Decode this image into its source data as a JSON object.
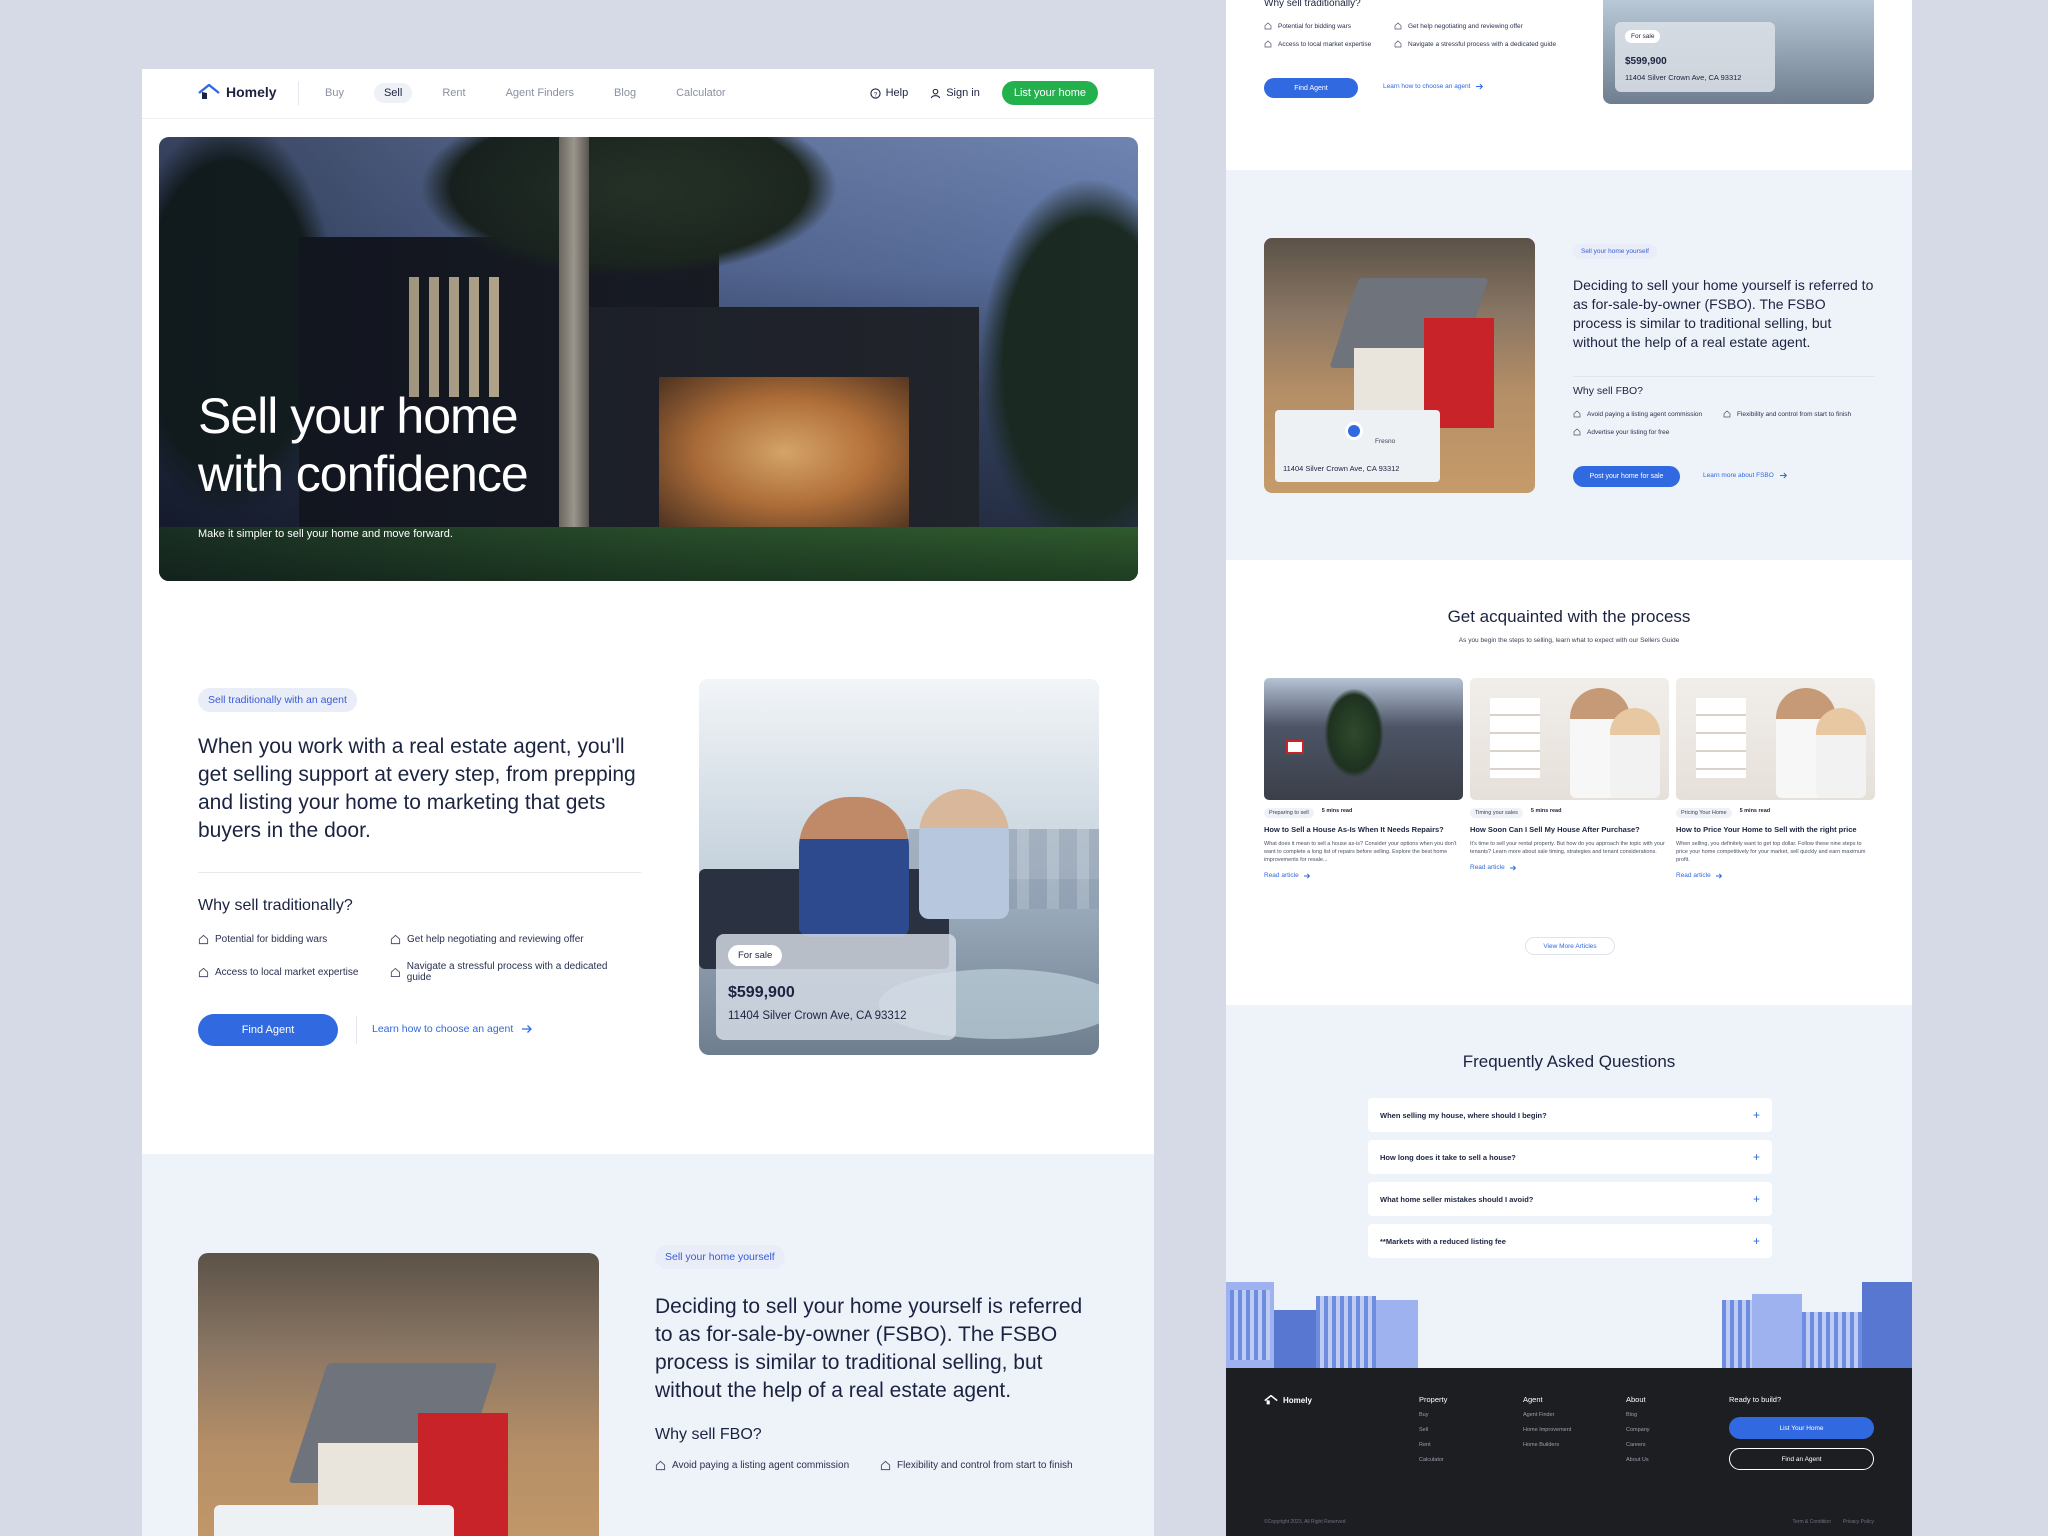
{
  "brand": {
    "name": "Homely",
    "accent": "#3169e0",
    "cta_green": "#22b14c"
  },
  "nav": {
    "links": [
      "Buy",
      "Sell",
      "Rent",
      "Agent Finders",
      "Blog",
      "Calculator"
    ],
    "active": "Sell",
    "help": "Help",
    "signin": "Sign in",
    "cta": "List your home"
  },
  "hero": {
    "title_line1": "Sell your home",
    "title_line2": "with confidence",
    "subtitle": "Make it simpler to sell your home and move forward."
  },
  "traditional": {
    "chip": "Sell traditionally with an agent",
    "lead": "When you work with a real estate agent, you'll get selling support at every step, from prepping and listing your home to marketing that gets buyers in the door.",
    "why_title": "Why sell traditionally?",
    "bullets": [
      "Potential for bidding wars",
      "Get help negotiating and reviewing offer",
      "Access to local market expertise",
      "Navigate a stressful process with a dedicated guide"
    ],
    "button": "Find Agent",
    "link": "Learn how to choose an agent",
    "card": {
      "tag": "For sale",
      "price": "$599,900",
      "address": "11404 Silver Crown Ave, CA 93312"
    }
  },
  "fsbo": {
    "chip": "Sell your home yourself",
    "lead": "Deciding to sell your home yourself is referred to as for-sale-by-owner (FSBO). The FSBO process is similar to traditional selling, but without the help of a real estate agent.",
    "why_title": "Why sell FBO?",
    "bullets": [
      "Avoid paying a listing agent commission",
      "Flexibility and control from start to finish",
      "Advertise your listing for free"
    ],
    "button": "Post your home for sale",
    "link": "Learn more about FSBO",
    "map": {
      "city": "Fresno",
      "address": "11404 Silver Crown Ave, CA 93312"
    }
  },
  "process": {
    "title": "Get acquainted with the process",
    "subtitle": "As you begin the steps to selling, learn what to expect with our Sellers Guide",
    "articles": [
      {
        "tag": "Preparing to sell",
        "read": "5 mins read",
        "title": "How to Sell a House As-Is When It Needs Repairs?",
        "desc": "What does it mean to sell a house as-is? Consider your options when you don't want to complete a long list of repairs before selling. Explore the best home improvements for resale...",
        "cta": "Read article"
      },
      {
        "tag": "Timing your sales",
        "read": "5 mins read",
        "title": "How Soon Can I Sell My House After Purchase?",
        "desc": "It's time to sell your rental property. But how do you approach the topic with your tenants? Learn more about sale timing, strategies and tenant considerations.",
        "cta": "Read article"
      },
      {
        "tag": "Pricing Your Home",
        "read": "5 mins read",
        "title": "How to Price Your Home to Sell with the right price",
        "desc": "When selling, you definitely want to get top dollar. Follow these nine steps to price your home competitively for your market, sell quickly and earn maximum profit.",
        "cta": "Read article"
      }
    ],
    "view_more": "View More Articles"
  },
  "faq": {
    "title": "Frequently Asked Questions",
    "items": [
      "When selling my house, where should I begin?",
      "How long does it take to sell a house?",
      "What home seller mistakes should I avoid?",
      "**Markets with a reduced listing fee"
    ]
  },
  "footer": {
    "columns": [
      {
        "heading": "Property",
        "items": [
          "Buy",
          "Sell",
          "Rent",
          "Calculator"
        ]
      },
      {
        "heading": "Agent",
        "items": [
          "Agent Finder",
          "Home Improvement",
          "Home Builders"
        ]
      },
      {
        "heading": "About",
        "items": [
          "Blog",
          "Company",
          "Careers",
          "About Us"
        ]
      }
    ],
    "cta_heading": "Ready to build?",
    "cta_primary": "List Your Home",
    "cta_secondary": "Find an Agent",
    "copyright": "©Copyright 2023, All Right Reserved",
    "terms": "Term & Condition",
    "privacy": "Privacy Policy"
  }
}
